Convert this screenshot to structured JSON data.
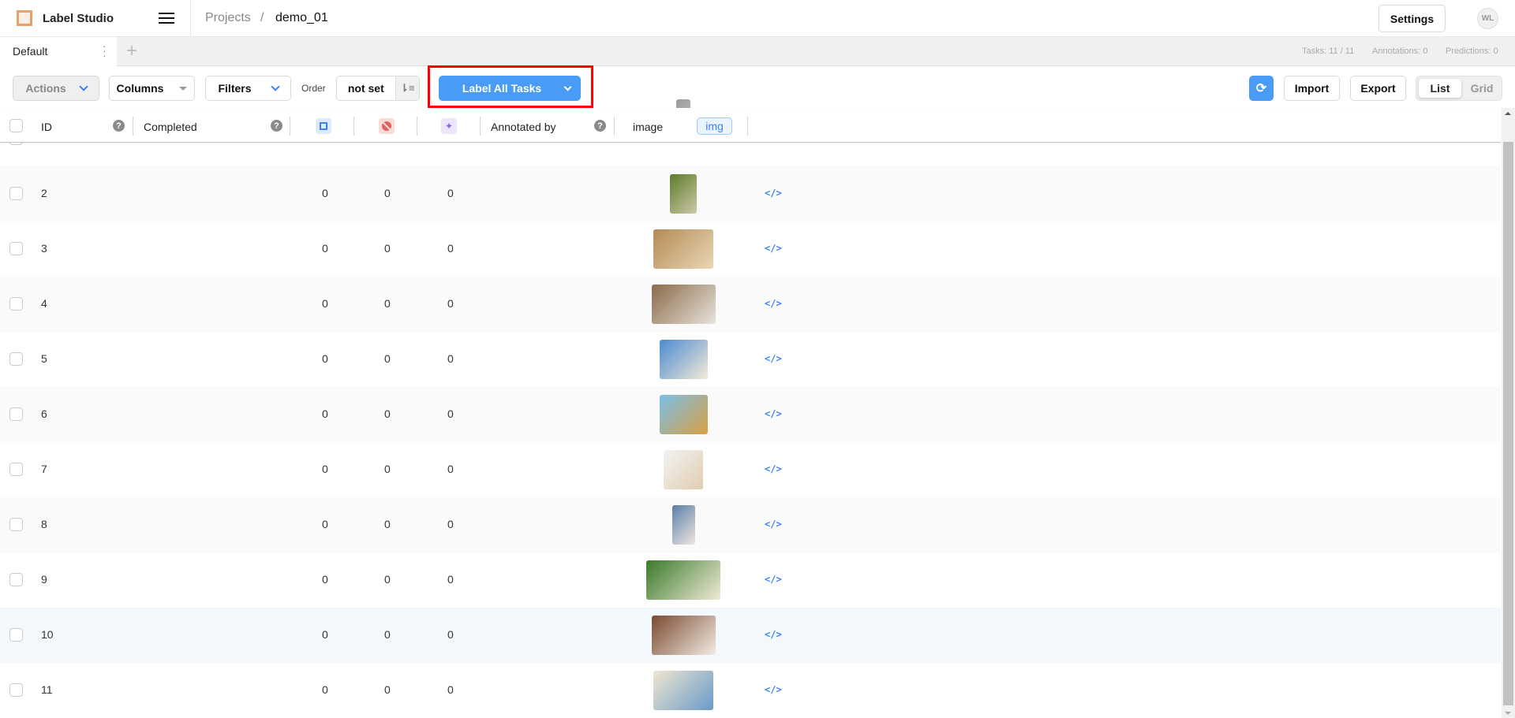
{
  "header": {
    "app_name": "Label Studio",
    "breadcrumb": [
      "Projects",
      "demo_01"
    ],
    "breadcrumb_sep": "/",
    "settings_label": "Settings",
    "avatar_initials": "WL"
  },
  "tabs": [
    {
      "label": "Default",
      "active": true
    }
  ],
  "add_tab_label": "+",
  "stats": {
    "tasks": "Tasks: 11 / 11",
    "annotations": "Annotations: 0",
    "predictions": "Predictions: 0"
  },
  "toolbar": {
    "actions_label": "Actions",
    "columns_label": "Columns",
    "filters_label": "Filters",
    "order_label": "Order",
    "order_value": "not set",
    "label_all_label": "Label All Tasks",
    "import_label": "Import",
    "export_label": "Export",
    "view_list": "List",
    "view_grid": "Grid",
    "active_view": "List",
    "accent_color": "#4a9bf5",
    "highlight_color": "#ff0000"
  },
  "columns": {
    "id": "ID",
    "completed": "Completed",
    "total_annotations_icon": "bounding-box-icon",
    "cancelled_icon": "cancel-icon",
    "predictions_icon": "sparkles-icon",
    "annotated_by": "Annotated by",
    "image": "image",
    "image_badge": "img",
    "help": "?"
  },
  "rows": [
    {
      "id": "",
      "annotations": "",
      "cancelled": "",
      "predictions": "",
      "thumb": [
        "#999",
        "#ccc"
      ]
    },
    {
      "id": "2",
      "annotations": "0",
      "cancelled": "0",
      "predictions": "0",
      "thumb": [
        "#5a7d2a",
        "#cfc7a8"
      ]
    },
    {
      "id": "3",
      "annotations": "0",
      "cancelled": "0",
      "predictions": "0",
      "thumb": [
        "#b58a55",
        "#e9d7b5"
      ]
    },
    {
      "id": "4",
      "annotations": "0",
      "cancelled": "0",
      "predictions": "0",
      "thumb": [
        "#8a6a4a",
        "#e8e4dc"
      ]
    },
    {
      "id": "5",
      "annotations": "0",
      "cancelled": "0",
      "predictions": "0",
      "thumb": [
        "#4a8ad0",
        "#f4ead8"
      ]
    },
    {
      "id": "6",
      "annotations": "0",
      "cancelled": "0",
      "predictions": "0",
      "thumb": [
        "#7ac0e8",
        "#d8a040"
      ]
    },
    {
      "id": "7",
      "annotations": "0",
      "cancelled": "0",
      "predictions": "0",
      "thumb": [
        "#f3f3f3",
        "#e0cdb0"
      ]
    },
    {
      "id": "8",
      "annotations": "0",
      "cancelled": "0",
      "predictions": "0",
      "thumb": [
        "#5a7ea8",
        "#f0e8e0"
      ]
    },
    {
      "id": "9",
      "annotations": "0",
      "cancelled": "0",
      "predictions": "0",
      "thumb": [
        "#3a7a2a",
        "#f0ead8"
      ]
    },
    {
      "id": "10",
      "annotations": "0",
      "cancelled": "0",
      "predictions": "0",
      "thumb": [
        "#7a4a30",
        "#f2ece4"
      ]
    },
    {
      "id": "11",
      "annotations": "0",
      "cancelled": "0",
      "predictions": "0",
      "thumb": [
        "#f0e6d0",
        "#6a9ac8"
      ]
    }
  ],
  "code_icon": "</>"
}
